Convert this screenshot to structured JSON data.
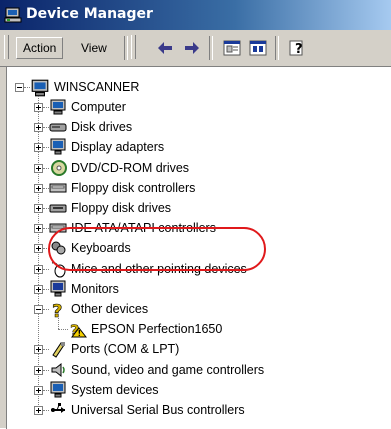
{
  "window": {
    "title": "Device Manager",
    "title_icon": "device-manager-icon"
  },
  "toolbar": {
    "action_label": "Action",
    "view_label": "View",
    "icons": [
      "back-arrow-icon",
      "forward-arrow-icon",
      "properties-icon",
      "scan-icon",
      "help-icon"
    ]
  },
  "tree": {
    "root": "WINSCANNER",
    "categories": [
      {
        "label": "Computer",
        "icon": "computer-icon",
        "expanded": false
      },
      {
        "label": "Disk drives",
        "icon": "disk-drive-icon",
        "expanded": false
      },
      {
        "label": "Display adapters",
        "icon": "display-adapter-icon",
        "expanded": false
      },
      {
        "label": "DVD/CD-ROM drives",
        "icon": "cdrom-icon",
        "expanded": false
      },
      {
        "label": "Floppy disk controllers",
        "icon": "floppy-controller-icon",
        "expanded": false
      },
      {
        "label": "Floppy disk drives",
        "icon": "floppy-drive-icon",
        "expanded": false
      },
      {
        "label": "IDE ATA/ATAPI controllers",
        "icon": "ide-controller-icon",
        "expanded": false
      },
      {
        "label": "Keyboards",
        "icon": "keyboard-icon",
        "expanded": false
      },
      {
        "label": "Mice and other pointing devices",
        "icon": "mouse-icon",
        "expanded": false
      },
      {
        "label": "Monitors",
        "icon": "monitor-icon",
        "expanded": false
      },
      {
        "label": "Other devices",
        "icon": "unknown-device-icon",
        "expanded": true,
        "children": [
          {
            "label": "EPSON Perfection1650",
            "icon": "warning-device-icon"
          }
        ]
      },
      {
        "label": "Ports (COM & LPT)",
        "icon": "port-icon",
        "expanded": false
      },
      {
        "label": "Sound, video and game controllers",
        "icon": "sound-icon",
        "expanded": false
      },
      {
        "label": "System devices",
        "icon": "system-device-icon",
        "expanded": false
      },
      {
        "label": "Universal Serial Bus controllers",
        "icon": "usb-icon",
        "expanded": false
      }
    ]
  },
  "colors": {
    "title_start": "#0a246a",
    "title_end": "#a6caf0",
    "highlight_ring": "#e0191b",
    "face": "#d4d0c8"
  }
}
